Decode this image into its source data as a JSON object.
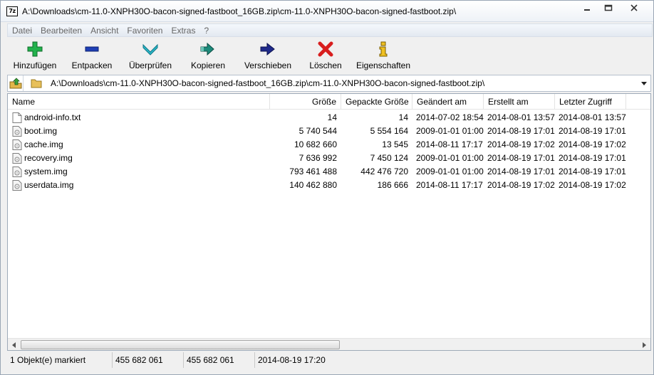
{
  "window": {
    "icon_text": "7z",
    "title": "A:\\Downloads\\cm-11.0-XNPH30O-bacon-signed-fastboot_16GB.zip\\cm-11.0-XNPH30O-bacon-signed-fastboot.zip\\"
  },
  "menu": [
    "Datei",
    "Bearbeiten",
    "Ansicht",
    "Favoriten",
    "Extras",
    "?"
  ],
  "toolbar": {
    "add": "Hinzufügen",
    "extract": "Entpacken",
    "test": "Überprüfen",
    "copy": "Kopieren",
    "move": "Verschieben",
    "delete": "Löschen",
    "info": "Eigenschaften"
  },
  "address": {
    "path": "A:\\Downloads\\cm-11.0-XNPH30O-bacon-signed-fastboot_16GB.zip\\cm-11.0-XNPH30O-bacon-signed-fastboot.zip\\"
  },
  "columns": {
    "name": "Name",
    "size": "Größe",
    "packed": "Gepackte Größe",
    "modified": "Geändert am",
    "created": "Erstellt am",
    "accessed": "Letzter Zugriff"
  },
  "files": [
    {
      "name": "android-info.txt",
      "size": "14",
      "packed": "14",
      "modified": "2014-07-02 18:54",
      "created": "2014-08-01 13:57",
      "accessed": "2014-08-01 13:57"
    },
    {
      "name": "boot.img",
      "size": "5 740 544",
      "packed": "5 554 164",
      "modified": "2009-01-01 01:00",
      "created": "2014-08-19 17:01",
      "accessed": "2014-08-19 17:01"
    },
    {
      "name": "cache.img",
      "size": "10 682 660",
      "packed": "13 545",
      "modified": "2014-08-11 17:17",
      "created": "2014-08-19 17:02",
      "accessed": "2014-08-19 17:02"
    },
    {
      "name": "recovery.img",
      "size": "7 636 992",
      "packed": "7 450 124",
      "modified": "2009-01-01 01:00",
      "created": "2014-08-19 17:01",
      "accessed": "2014-08-19 17:01"
    },
    {
      "name": "system.img",
      "size": "793 461 488",
      "packed": "442 476 720",
      "modified": "2009-01-01 01:00",
      "created": "2014-08-19 17:01",
      "accessed": "2014-08-19 17:01"
    },
    {
      "name": "userdata.img",
      "size": "140 462 880",
      "packed": "186 666",
      "modified": "2014-08-11 17:17",
      "created": "2014-08-19 17:02",
      "accessed": "2014-08-19 17:02"
    }
  ],
  "status": {
    "selected": "1 Objekt(e) markiert",
    "size": "455 682 061",
    "packed": "455 682 061",
    "date": "2014-08-19 17:20"
  },
  "icons": {
    "add": "plus-icon",
    "extract": "minus-icon",
    "test": "check-chevron-icon",
    "copy": "arrow-right-double-icon",
    "move": "arrow-right-icon",
    "delete": "x-icon",
    "info": "info-icon"
  },
  "colors": {
    "add": "#22b14c",
    "extract": "#1f3fb5",
    "test": "#2ab7c8",
    "copy": "#1d8a7a",
    "move": "#1f2a8a",
    "delete": "#d81e1e",
    "info": "#f0c020"
  }
}
